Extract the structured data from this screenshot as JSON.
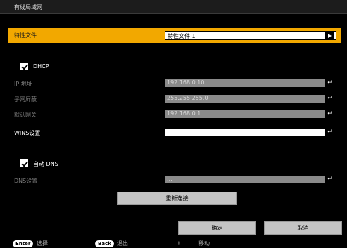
{
  "title": "有线局域网",
  "profile": {
    "label": "特性文件",
    "value": "特性文件 1",
    "icon": "play-icon"
  },
  "dhcp": {
    "label": "DHCP",
    "checked": true
  },
  "fields": {
    "ip": {
      "label": "IP 地址",
      "value": "192.168.0.10"
    },
    "subnet": {
      "label": "子网屏蔽",
      "value": "255.255.255.0"
    },
    "gateway": {
      "label": "默认网关",
      "value": "192.168.0.1"
    },
    "wins": {
      "label": "WINS设置",
      "value": "..."
    },
    "dns": {
      "label": "DNS设置",
      "value": "..."
    }
  },
  "auto_dns": {
    "label": "自动 DNS",
    "checked": true
  },
  "enter_glyph": "↵",
  "buttons": {
    "reconnect": "重新连接",
    "ok": "确定",
    "cancel": "取消"
  },
  "footer": {
    "enter_key": "Enter",
    "enter_action": "选择",
    "back_key": "Back",
    "back_action": "退出",
    "move_glyph": "⇕",
    "move_action": "移动"
  },
  "colors": {
    "accent": "#f2a800",
    "disabled_field": "#8a8a8a",
    "button": "#c4c4c4",
    "background": "#000000"
  }
}
